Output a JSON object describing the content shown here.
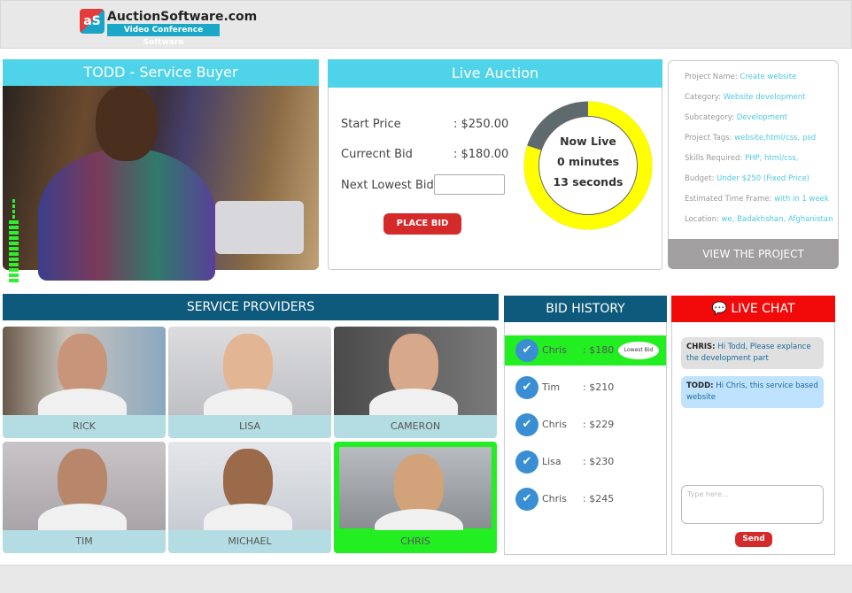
{
  "header": {
    "logo_mark": "aS",
    "logo_name": "AuctionSoftware.com",
    "logo_sub": "Video Conference Software"
  },
  "buyer": {
    "title": "TODD - Service Buyer",
    "audio_level": 0.6
  },
  "auction": {
    "title": "Live Auction",
    "start_price_label": "Start Price",
    "start_price": ": $250.00",
    "current_bid_label": "Currecnt Bid",
    "current_bid": ": $180.00",
    "next_bid_label": "Next Lowest Bid",
    "next_bid_value": "",
    "place_bid": "PLACE BID",
    "timer": {
      "line1": "Now Live",
      "line2": "0 minutes",
      "line3": "13 seconds",
      "remaining_fraction": 0.8,
      "colors": {
        "remaining": "#ffff00",
        "elapsed": "#5f6a6e"
      }
    }
  },
  "project": {
    "fields": [
      {
        "label": "Project Name:",
        "value": "Create website"
      },
      {
        "label": "Category:",
        "value": "Website development"
      },
      {
        "label": "Subcategory:",
        "value": "Development"
      },
      {
        "label": "Project Tags:",
        "value": "website,html/css, psd"
      },
      {
        "label": "Skills Required:",
        "value": "PHP, html/css,"
      },
      {
        "label": "Budget:",
        "value": "Under $250 (Fixed Price)"
      },
      {
        "label": "Estimated Time Frame:",
        "value": "with in 1 week"
      },
      {
        "label": "Location:",
        "value": "we, Badakhshan, Afghanistan"
      }
    ],
    "view_button": "VIEW THE PROJECT"
  },
  "providers": {
    "title": "SERVICE PROVIDERS",
    "items": [
      {
        "name": "RICK"
      },
      {
        "name": "LISA"
      },
      {
        "name": "CAMERON"
      },
      {
        "name": "TIM"
      },
      {
        "name": "MICHAEL"
      },
      {
        "name": "CHRIS",
        "active": true
      }
    ]
  },
  "bid_history": {
    "title": "BID HISTORY",
    "lowest_label": "Lowest Bid",
    "rows": [
      {
        "name": "Chris",
        "amount": ": $180"
      },
      {
        "name": "Tim",
        "amount": ": $210"
      },
      {
        "name": "Chris",
        "amount": ": $229"
      },
      {
        "name": "Lisa",
        "amount": ": $230"
      },
      {
        "name": "Chris",
        "amount": ": $245"
      }
    ]
  },
  "chat": {
    "title": "LIVE CHAT",
    "messages": [
      {
        "sender": "CHRIS:",
        "text": "Hi Todd, Please explance the development part"
      },
      {
        "sender": "TODD:",
        "text": "Hi Chris, this service based website"
      }
    ],
    "placeholder": "Type here...",
    "send": "Send"
  },
  "colors": {
    "accent": "#4fd3e8",
    "navy": "#0d5a7c",
    "highlight": "#22ee22",
    "red": "#d42a2a",
    "chat_red": "#f20a0a"
  }
}
